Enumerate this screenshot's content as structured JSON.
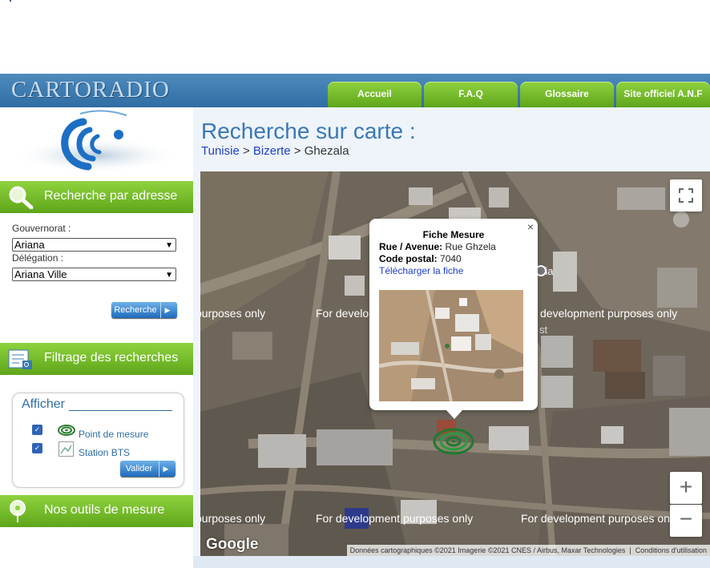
{
  "app": {
    "logo_text": "CARTORADIO"
  },
  "nav": {
    "tabs": [
      "Accueil",
      "F.A.Q",
      "Glossaire",
      "Site officiel A.N.F"
    ]
  },
  "sidebar": {
    "search_section": "Recherche par adresse",
    "gouvernorat_label": "Gouvernorat :",
    "gouvernorat_value": "Ariana",
    "delegation_label": "Délégation :",
    "delegation_value": "Ariana Ville",
    "search_button": "Recherche",
    "filter_section": "Filtrage des recherches",
    "filter": {
      "title": "Afficher",
      "items": [
        {
          "label": "Point de mesure",
          "checked": true
        },
        {
          "label": "Station BTS",
          "checked": true
        }
      ],
      "validate_button": "Valider"
    },
    "tools_section": "Nos outils de mesure"
  },
  "main": {
    "title": "Recherche sur carte :",
    "breadcrumb": {
      "level1": "Tunisie",
      "sep1": ">",
      "level2": "Bizerte",
      "sep2": ">",
      "level3": "Ghezala"
    }
  },
  "map": {
    "watermark": {
      "tl": "purposes only",
      "tm": "For development purposes only",
      "tr": "development purposes only",
      "bl": "purposes only",
      "bm": "For development purposes only",
      "br": "For development purposes on"
    },
    "label_fragment_1": "isia",
    "label_fragment_2": "st",
    "google_logo": "Google",
    "attribution": "Données cartographiques ©2021 Imagerie ©2021 CNES / Airbus, Maxar Technologies",
    "terms": "Conditions d'utilisation",
    "zoom_in": "+",
    "zoom_out": "−",
    "popup": {
      "title": "Fiche Mesure",
      "street_label": "Rue / Avenue:",
      "street_value": "Rue Ghzela",
      "postal_label": "Code postal:",
      "postal_value": "7040",
      "download_link": "Télécharger la fiche",
      "close": "×"
    }
  },
  "colors": {
    "header_blue": "#2f6da3",
    "tab_green": "#6fb62a",
    "title_blue": "#3a78b5",
    "link": "#1f3fbf"
  },
  "icons": [
    "magnifier-icon",
    "filter-list-icon",
    "measure-point-icon",
    "bts-station-icon",
    "tools-pin-icon",
    "fullscreen-icon",
    "cartoradio-logo"
  ]
}
